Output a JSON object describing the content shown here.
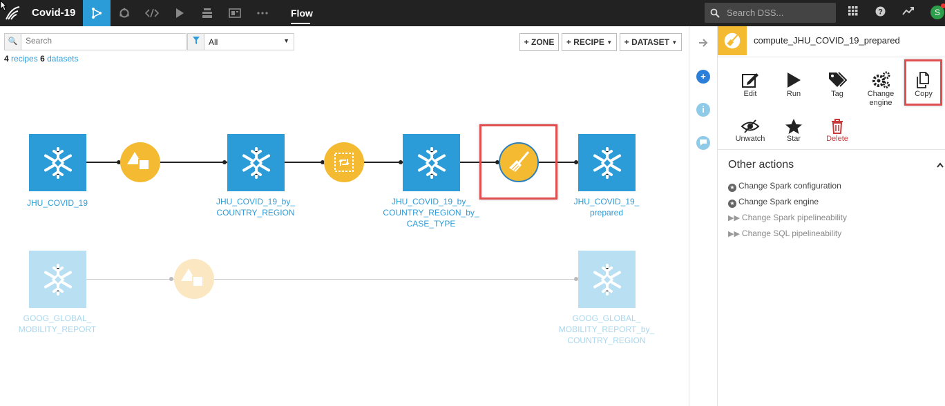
{
  "topbar": {
    "project_name": "Covid-19",
    "flow_label": "Flow",
    "search_placeholder": "Search DSS...",
    "avatar_initial": "S",
    "nav_icons": [
      "flow-icon",
      "cycle-icon",
      "code-icon",
      "run-icon",
      "stack-icon",
      "dashboard-icon",
      "more-icon"
    ],
    "right_icons": [
      "apps-grid-icon",
      "help-icon",
      "trend-icon"
    ]
  },
  "toolbar": {
    "search_placeholder": "Search",
    "filter_value": "All",
    "zone_btn": "+ ZONE",
    "recipe_btn": "+ RECIPE",
    "dataset_btn": "+ DATASET",
    "recipes_count": "4",
    "recipes_word": "recipes",
    "datasets_count": "6",
    "datasets_word": "datasets"
  },
  "flow": {
    "datasets": [
      {
        "line1": "JHU_COVID_19",
        "line2": "",
        "line3": ""
      },
      {
        "line1": "JHU_COVID_19_by_",
        "line2": "COUNTRY_REGION",
        "line3": ""
      },
      {
        "line1": "JHU_COVID_19_by_",
        "line2": "COUNTRY_REGION_by_",
        "line3": "CASE_TYPE"
      },
      {
        "line1": "JHU_COVID_19_",
        "line2": "prepared",
        "line3": ""
      },
      {
        "line1": "GOOG_GLOBAL_",
        "line2": "MOBILITY_REPORT",
        "line3": ""
      },
      {
        "line1": "GOOG_GLOBAL_",
        "line2": "MOBILITY_REPORT_by_",
        "line3": "COUNTRY_REGION"
      }
    ],
    "recipes": [
      "group-recipe-icon",
      "pivot-recipe-icon",
      "prepare-recipe-icon",
      "group-recipe-icon"
    ]
  },
  "panel": {
    "title": "compute_JHU_COVID_19_prepared",
    "actions": {
      "edit": "Edit",
      "run": "Run",
      "tag": "Tag",
      "change_engine_1": "Change",
      "change_engine_2": "engine",
      "copy": "Copy",
      "unwatch": "Unwatch",
      "star": "Star",
      "delete": "Delete"
    },
    "other_actions_title": "Other actions",
    "other_actions": [
      "Change Spark configuration",
      "Change Spark engine",
      "Change Spark pipelineability",
      "Change SQL pipelineability"
    ]
  },
  "colors": {
    "accent": "#2c9cd8",
    "recipe": "#f4bb32",
    "highlight": "#e04f4f",
    "topbar": "#222222",
    "delete": "#c83a3a"
  }
}
